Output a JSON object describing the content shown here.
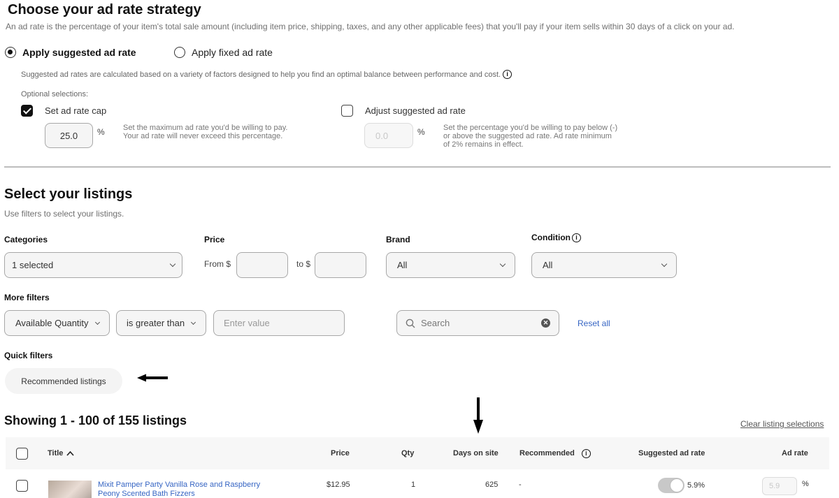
{
  "strategy": {
    "title": "Choose your ad rate strategy",
    "description": "An ad rate is the percentage of your item's total sale amount (including item price, shipping, taxes, and any other applicable fees) that you'll pay if your item sells within 30 days of a click on your ad.",
    "options": [
      {
        "label": "Apply suggested ad rate",
        "selected": true
      },
      {
        "label": "Apply fixed ad rate",
        "selected": false
      }
    ],
    "suggested_note": "Suggested ad rates are calculated based on a variety of factors designed to help you find an optimal balance between performance and cost.",
    "optional_label": "Optional selections:",
    "cap": {
      "label": "Set ad rate cap",
      "checked": true,
      "value": "25.0",
      "unit": "%",
      "help_line1": "Set the maximum ad rate you'd be willing to pay.",
      "help_line2": "Your ad rate will never exceed this percentage."
    },
    "adjust": {
      "label": "Adjust suggested ad rate",
      "checked": false,
      "value": "0.0",
      "unit": "%",
      "help_line1": "Set the percentage you'd be willing to pay below (-)",
      "help_line2": "or above the suggested ad rate. Ad rate minimum",
      "help_line3": "of 2% remains in effect."
    }
  },
  "listings": {
    "title": "Select your listings",
    "description": "Use filters to select your listings.",
    "filters": {
      "categories_label": "Categories",
      "categories_value": "1 selected",
      "price_label": "Price",
      "price_from_label": "From $",
      "price_to_label": "to $",
      "price_from_value": "",
      "price_to_value": "",
      "brand_label": "Brand",
      "brand_value": "All",
      "condition_label": "Condition",
      "condition_value": "All"
    },
    "more_filters": {
      "label": "More filters",
      "field_value": "Available Quantity",
      "operator_value": "is greater than",
      "value_placeholder": "Enter value",
      "search_placeholder": "Search",
      "reset_label": "Reset all"
    },
    "quick_filters": {
      "label": "Quick filters",
      "chip": "Recommended listings"
    },
    "showing": "Showing 1 - 100 of 155 listings",
    "clear_label": "Clear listing selections",
    "columns": {
      "title": "Title",
      "price": "Price",
      "qty": "Qty",
      "days": "Days on site",
      "recommended": "Recommended",
      "suggested": "Suggested ad rate",
      "ad_rate": "Ad rate"
    },
    "rows": [
      {
        "title_line1": "Mixit Pamper Party Vanilla Rose and Raspberry",
        "title_line2": "Peony Scented Bath Fizzers",
        "price": "$12.95",
        "qty": "1",
        "days": "625",
        "recommended": "-",
        "suggested_rate": "5.9%",
        "suggested_toggle_on": false,
        "ad_rate": "5.9",
        "ad_rate_unit": "%"
      }
    ]
  },
  "annotations": {
    "arrow_left_color": "#000000",
    "arrow_down_color": "#000000"
  }
}
